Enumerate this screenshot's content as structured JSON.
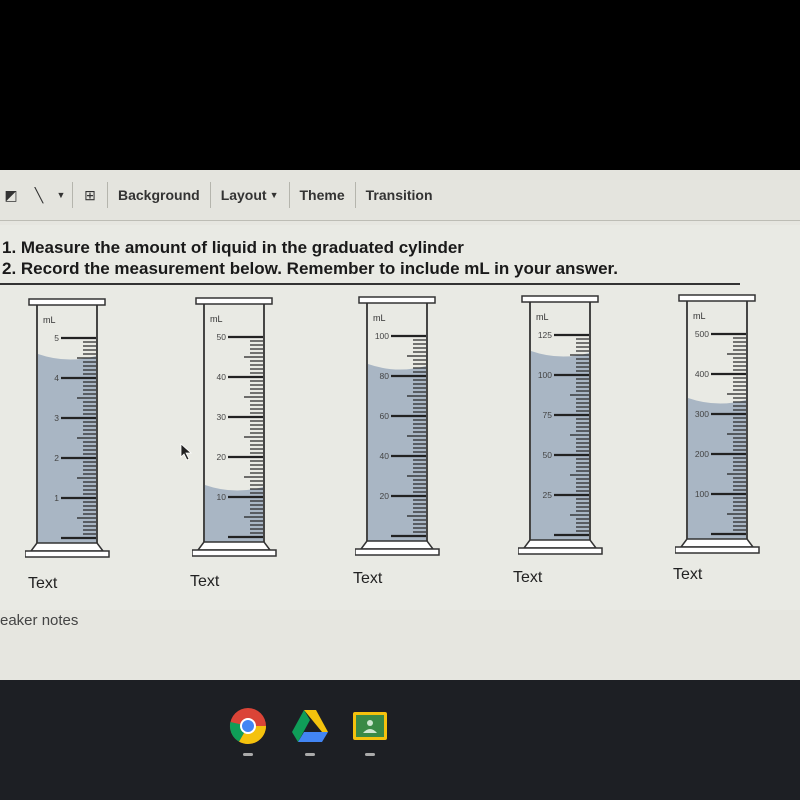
{
  "toolbar": {
    "items": [
      {
        "name": "line-tool",
        "icon": "line-icon"
      },
      {
        "name": "comment",
        "icon": "add-comment-icon"
      },
      {
        "label": "Background"
      },
      {
        "label": "Layout",
        "dropdown": true
      },
      {
        "label": "Theme"
      },
      {
        "label": "Transition"
      }
    ]
  },
  "slide": {
    "instructions": [
      "1. Measure the amount of liquid in the graduated cylinder",
      "2. Record the measurement below. Remember to include mL in your answer."
    ],
    "unit_label": "mL",
    "cylinders": [
      {
        "labels": [
          "5",
          "4",
          "3",
          "2",
          "1"
        ],
        "max": 5,
        "liquid_level": 4.6
      },
      {
        "labels": [
          "50",
          "40",
          "30",
          "20",
          "10"
        ],
        "max": 50,
        "liquid_level": 13
      },
      {
        "labels": [
          "100",
          "80",
          "60",
          "40",
          "20"
        ],
        "max": 100,
        "liquid_level": 86
      },
      {
        "labels": [
          "125",
          "100",
          "75",
          "50",
          "25"
        ],
        "max": 125,
        "liquid_level": 115
      },
      {
        "labels": [
          "500",
          "400",
          "300",
          "200",
          "100"
        ],
        "max": 500,
        "liquid_level": 340
      }
    ],
    "answer_boxes": [
      "Text",
      "Text",
      "Text",
      "Text",
      "Text"
    ]
  },
  "speaker_notes": "eaker notes",
  "shelf": {
    "apps": [
      "Chrome",
      "Google Drive",
      "Google Classroom"
    ]
  },
  "colors": {
    "liquid": "#a9b6c4",
    "classroom_green": "#3a8a46",
    "classroom_border": "#f4c20d"
  }
}
